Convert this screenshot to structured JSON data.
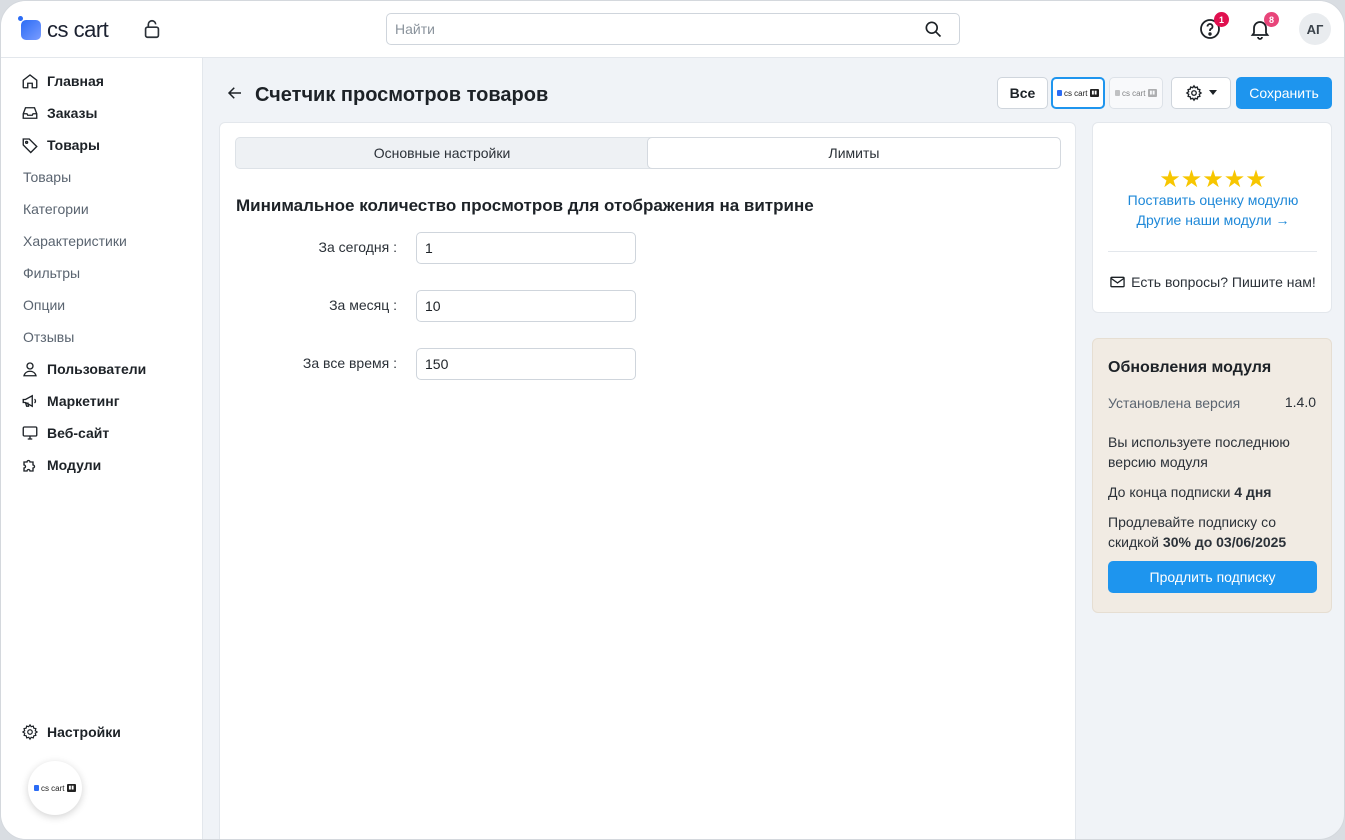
{
  "header": {
    "logo_text": "cs cart",
    "search_placeholder": "Найти",
    "help_badge": "1",
    "notifications_badge": "8",
    "avatar_initials": "АГ",
    "colors": {
      "help_badge": "#e0104f",
      "notifications_badge": "#e8457a"
    }
  },
  "sidebar": {
    "main_items": [
      {
        "label": "Главная",
        "icon": "home-icon"
      },
      {
        "label": "Заказы",
        "icon": "inbox-icon"
      },
      {
        "label": "Товары",
        "icon": "tag-icon"
      }
    ],
    "product_subitems": [
      "Товары",
      "Категории",
      "Характеристики",
      "Фильтры",
      "Опции",
      "Отзывы"
    ],
    "more_items": [
      {
        "label": "Пользователи",
        "icon": "user-icon"
      },
      {
        "label": "Маркетинг",
        "icon": "megaphone-icon"
      },
      {
        "label": "Веб-сайт",
        "icon": "monitor-icon"
      },
      {
        "label": "Модули",
        "icon": "puzzle-icon"
      }
    ],
    "settings_label": "Настройки",
    "badge_logo_text": "cs cart"
  },
  "page": {
    "title": "Счетчик просмотров товаров",
    "filter_all": "Все",
    "store_logo_text": "cs cart",
    "save_label": "Сохранить"
  },
  "tabs": [
    {
      "label": "Основные настройки",
      "active": false
    },
    {
      "label": "Лимиты",
      "active": true
    }
  ],
  "form": {
    "section_title": "Минимальное количество просмотров для отображения на витрине",
    "fields": [
      {
        "label": "За сегодня :",
        "value": "1"
      },
      {
        "label": "За месяц :",
        "value": "10"
      },
      {
        "label": "За все время :",
        "value": "150"
      }
    ]
  },
  "rating_card": {
    "stars": "★★★★★",
    "rate_link": "Поставить оценку модулю",
    "other_link": "Другие наши модули →",
    "contact": "Есть вопросы? Пишите нам!"
  },
  "updates_card": {
    "title": "Обновления модуля",
    "installed_label": "Установлена версия",
    "installed_version": "1.4.0",
    "latest_note": "Вы используете последнюю версию модуля",
    "sub_prefix": "До конца подписки",
    "sub_days": "4 дня",
    "renew_prefix": "Продлевайте подписку со скидкой",
    "renew_offer": "30% до 03/06/2025",
    "renew_button": "Продлить подписку"
  },
  "colors": {
    "accent": "#1e95ee",
    "link": "#1e88d8",
    "star": "#f7c600",
    "update_bg": "#f1ebe3"
  }
}
